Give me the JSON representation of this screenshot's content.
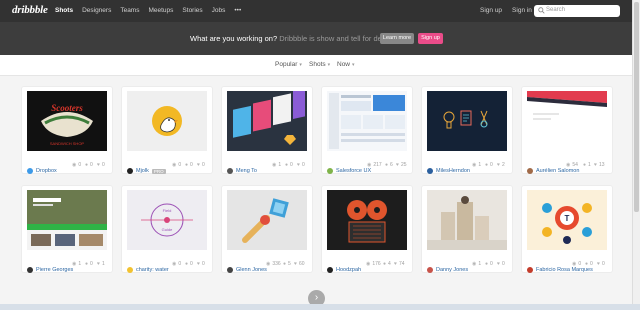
{
  "nav": {
    "logo": "dribbble",
    "links": [
      "Shots",
      "Designers",
      "Teams",
      "Meetups",
      "Stories",
      "Jobs",
      "•••"
    ],
    "signup": "Sign up",
    "signin": "Sign in",
    "search_placeholder": "Search"
  },
  "banner": {
    "question": "What are you working on?",
    "tagline": "Dribbble is show and tell for designers.",
    "learn_more": "Learn more",
    "sign_up": "Sign up"
  },
  "filters": {
    "popular": "Popular",
    "shots": "Shots",
    "now": "Now"
  },
  "shots": [
    {
      "author": "Dropbox",
      "views": "0",
      "comments": "0",
      "likes": "0",
      "avatar_color": "#3d9ae8",
      "pro": false
    },
    {
      "author": "Mjolk",
      "views": "0",
      "comments": "0",
      "likes": "0",
      "avatar_color": "#222222",
      "pro": true,
      "pro_label": "PRO"
    },
    {
      "author": "Meng To",
      "views": "1",
      "comments": "0",
      "likes": "0",
      "avatar_color": "#555555",
      "pro": false
    },
    {
      "author": "Salesforce UX",
      "views": "217",
      "comments": "6",
      "likes": "25",
      "avatar_color": "#7fb34a",
      "pro": false
    },
    {
      "author": "MilesHerndon",
      "views": "1",
      "comments": "0",
      "likes": "2",
      "avatar_color": "#2b5f9e",
      "pro": false
    },
    {
      "author": "Aurélien Salomon",
      "views": "54",
      "comments": "1",
      "likes": "13",
      "avatar_color": "#a06a48",
      "pro": false
    },
    {
      "author": "Pierre Georges",
      "views": "1",
      "comments": "0",
      "likes": "1",
      "avatar_color": "#333333",
      "pro": false
    },
    {
      "author": "charity: water",
      "views": "0",
      "comments": "0",
      "likes": "0",
      "avatar_color": "#f2c230",
      "pro": false
    },
    {
      "author": "Glenn Jones",
      "views": "336",
      "comments": "5",
      "likes": "60",
      "avatar_color": "#444444",
      "pro": false
    },
    {
      "author": "Hoodzpah",
      "views": "176",
      "comments": "4",
      "likes": "74",
      "avatar_color": "#222222",
      "pro": false
    },
    {
      "author": "Danny Jones",
      "views": "1",
      "comments": "0",
      "likes": "0",
      "avatar_color": "#c7534a",
      "pro": false
    },
    {
      "author": "Fabricio Rosa Marques",
      "views": "0",
      "comments": "0",
      "likes": "0",
      "avatar_color": "#c33c2b",
      "pro": false
    }
  ],
  "load_more": "›"
}
